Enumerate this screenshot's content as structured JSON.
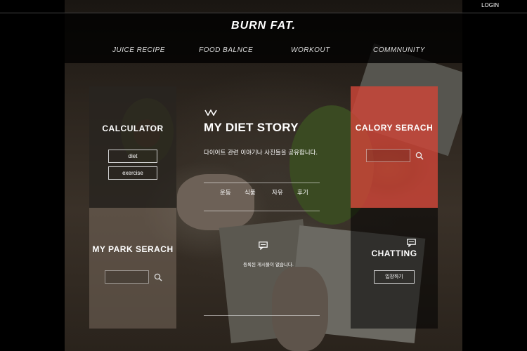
{
  "header": {
    "login": "LOGIN",
    "logo": "BURN FAT.",
    "nav": [
      "JUICE RECIPE",
      "FOOD BALNCE",
      "WORKOUT",
      "COMMNUNITY"
    ]
  },
  "calculator": {
    "title": "CALCULATOR",
    "buttons": [
      "diet",
      "exercise"
    ]
  },
  "park_search": {
    "title": "MY PARK SERACH"
  },
  "calory_search": {
    "title": "CALORY SERACH"
  },
  "story": {
    "title": "MY DIET STORY",
    "subtitle": "다이어트 관련 이야기나 사진들을 공유합니다.",
    "tabs": [
      "운동",
      "식품",
      "자유",
      "후기"
    ],
    "notice": "등록된 게시물이 없습니다."
  },
  "chatting": {
    "title": "CHATTING",
    "enter": "입장하기"
  },
  "colors": {
    "accent_red": "#ce4638",
    "background": "#000000"
  },
  "icons": [
    "search-icon",
    "chat-icon",
    "wave-icon"
  ]
}
